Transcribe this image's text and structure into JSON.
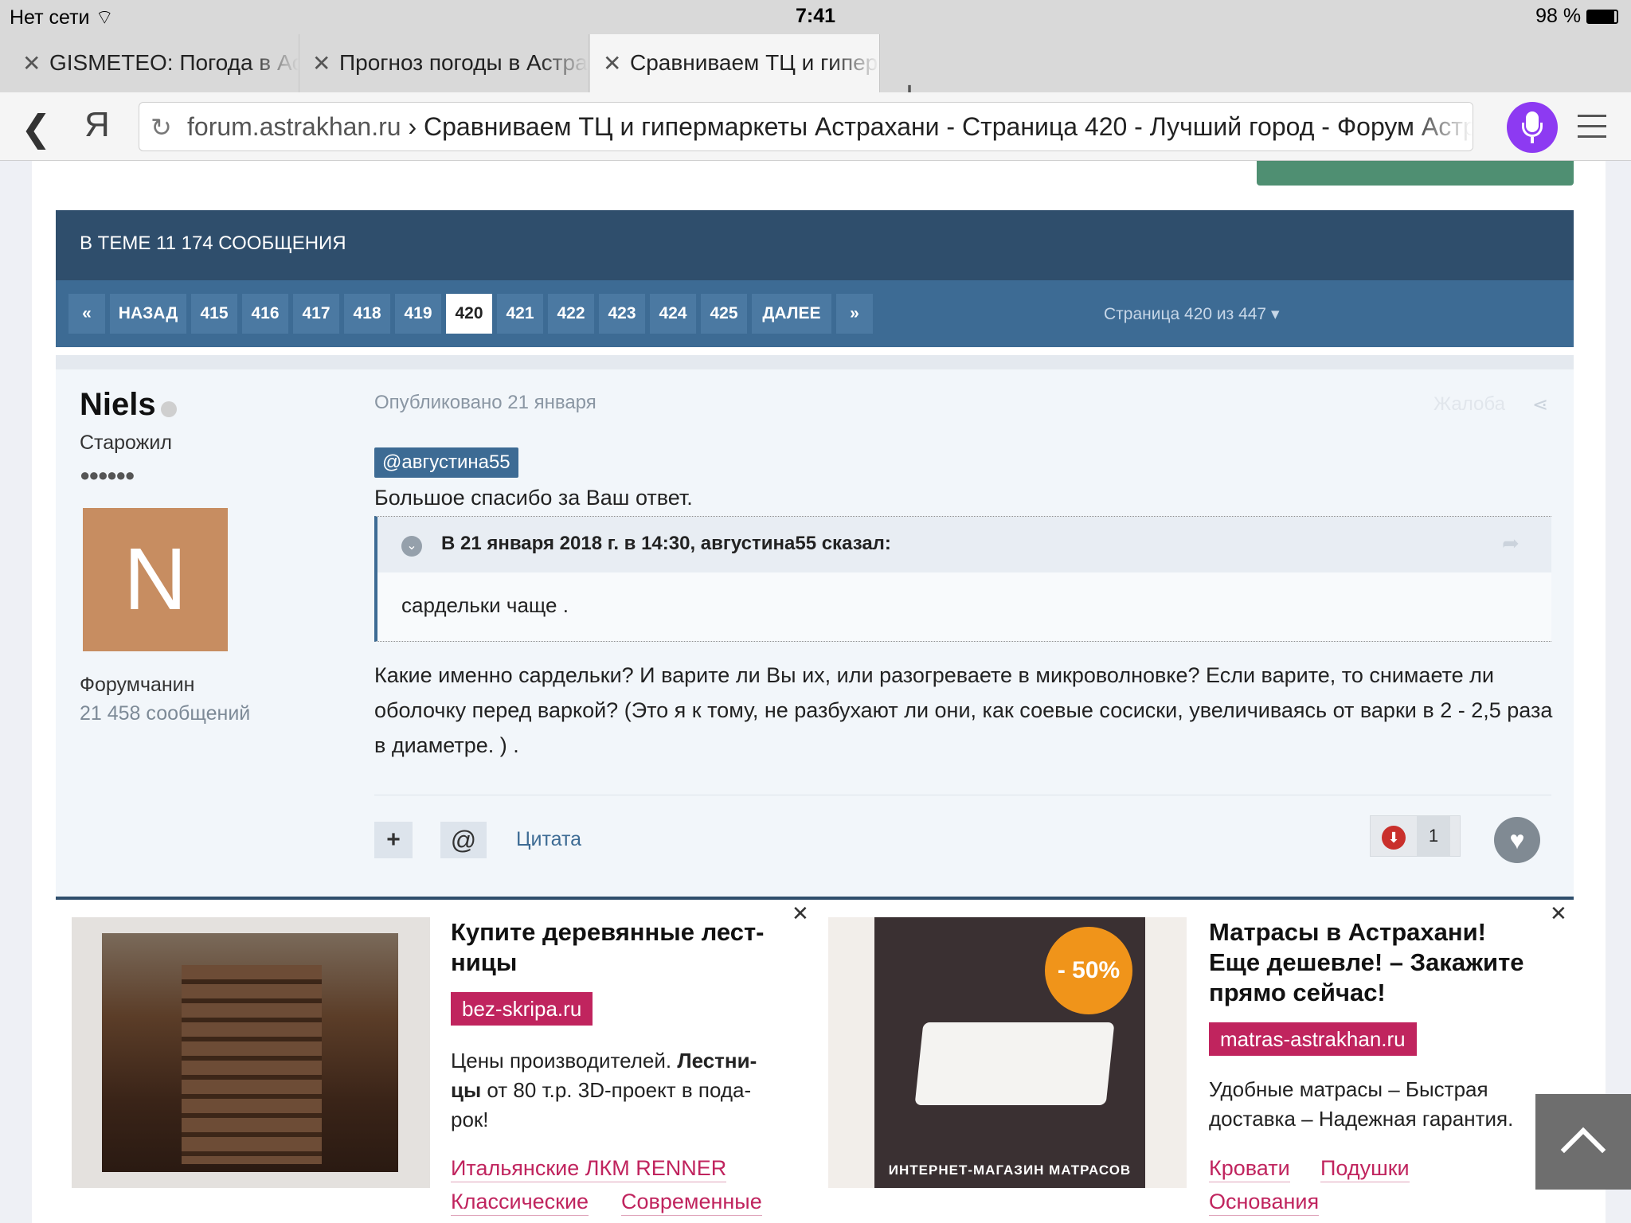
{
  "status": {
    "network": "Нет сети",
    "time": "7:41",
    "battery": "98 %"
  },
  "tabs": [
    {
      "label": "GISMETEO: Погода в Астрахани"
    },
    {
      "label": "Прогноз погоды в Астрахани"
    },
    {
      "label": "Сравниваем ТЦ и гипермаркеты Астрахани"
    }
  ],
  "browser": {
    "logo": "Я",
    "domain": "forum.astrakhan.ru",
    "separator": " › ",
    "page_title": "Сравниваем ТЦ и гипермаркеты Астрахани - Страница 420 - Лучший город - Форум Астрахани"
  },
  "topic": {
    "header": "В ТЕМЕ 11 174 СООБЩЕНИЯ"
  },
  "pagination": {
    "first": "«",
    "prev": "НАЗАД",
    "pages": [
      "415",
      "416",
      "417",
      "418",
      "419",
      "420",
      "421",
      "422",
      "423",
      "424",
      "425"
    ],
    "current": "420",
    "next": "ДАЛЕЕ",
    "last": "»",
    "info": "Страница 420 из 447 ▾"
  },
  "post": {
    "username": "Niels",
    "rank": "Старожил",
    "pips": "●●●●●●",
    "avatar_letter": "N",
    "group": "Форумчанин",
    "post_count": "21 458 сообщений",
    "date": "Опубликовано 21 января",
    "report": "Жалоба",
    "mention": "@августина55",
    "thanks": "Большое спасибо за Ваш ответ.",
    "quote_title": "В 21 января 2018 г. в 14:30, августина55 сказал:",
    "quote_text": "сардельки чаще .",
    "body": "Какие именно сардельки? И варите ли Вы их, или разогреваете в микроволновке? Если варите, то снимаете ли оболочку перед варкой? (Это я к тому, не разбухают ли они, как соевые сосиски, увеличиваясь от варки в 2 - 2,5 раза в диаметре. ) .",
    "quote_action": "Цитата",
    "reputation": "1"
  },
  "ads": [
    {
      "title": "Купите деревянные лест-ницы",
      "domain": "bez-skripa.ru",
      "text_a": "Цены производителей. ",
      "text_b": "Лестни-цы",
      "text_c": " от 80 т.р. 3D-проект в пода-рок!",
      "links": [
        "Итальянские ЛКМ RENNER",
        "Классические",
        "Современные"
      ]
    },
    {
      "title": "Матрасы в Астрахани! Еще дешевле! – Закажите прямо сейчас!",
      "domain": "matras-astrakhan.ru",
      "text": "Удобные матрасы – Быстрая доставка – Надежная гарантия.",
      "badge": "- 50%",
      "image_caption": "ИНТЕРНЕТ-МАГАЗИН МАТРАСОВ",
      "links": [
        "Кровати",
        "Подушки",
        "Основания"
      ]
    }
  ]
}
